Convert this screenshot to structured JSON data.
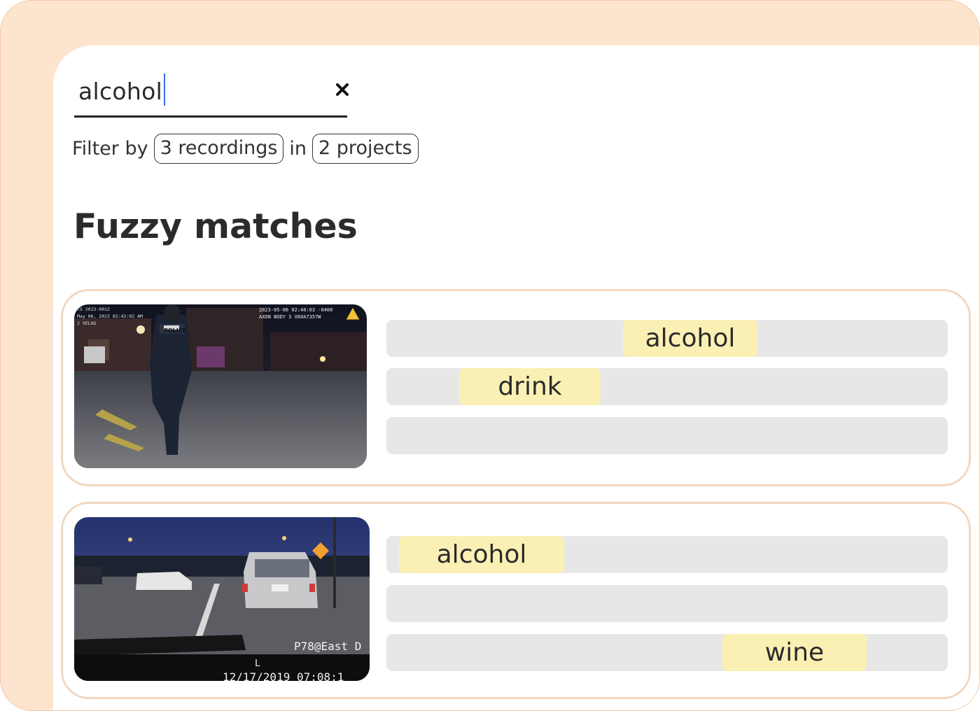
{
  "search": {
    "value": "alcohol",
    "clear_label": "×"
  },
  "filter": {
    "prefix": "Filter by",
    "recordings": "3 recordings",
    "connector": "in",
    "projects": "2 projects"
  },
  "section_title": "Fuzzy matches",
  "results": [
    {
      "video": {
        "overlay_left": [
          "TS 2023-0012",
          "May 06, 2023 02:42:02 AM",
          "J VELAS"
        ],
        "overlay_right": [
          "2023-05-06 02:40:03 -0400",
          "AXON BODY 3  X60A7357W"
        ],
        "vest_text": "POLICE"
      },
      "lines": [
        {
          "term": "alcohol"
        },
        {
          "term": "drink"
        },
        {
          "term": ""
        }
      ]
    },
    {
      "video": {
        "overlay_location": "P78@East D",
        "overlay_marker": "L",
        "overlay_timestamp": "12/17/2019 07:08:1"
      },
      "lines": [
        {
          "term": "alcohol"
        },
        {
          "term": ""
        },
        {
          "term": "wine"
        }
      ]
    }
  ],
  "colors": {
    "frame": "#fde4cf",
    "card_border": "#f1d8c2",
    "bar": "#e7e7e7",
    "highlight": "#fbf0b4",
    "caret": "#3b6ee0"
  }
}
